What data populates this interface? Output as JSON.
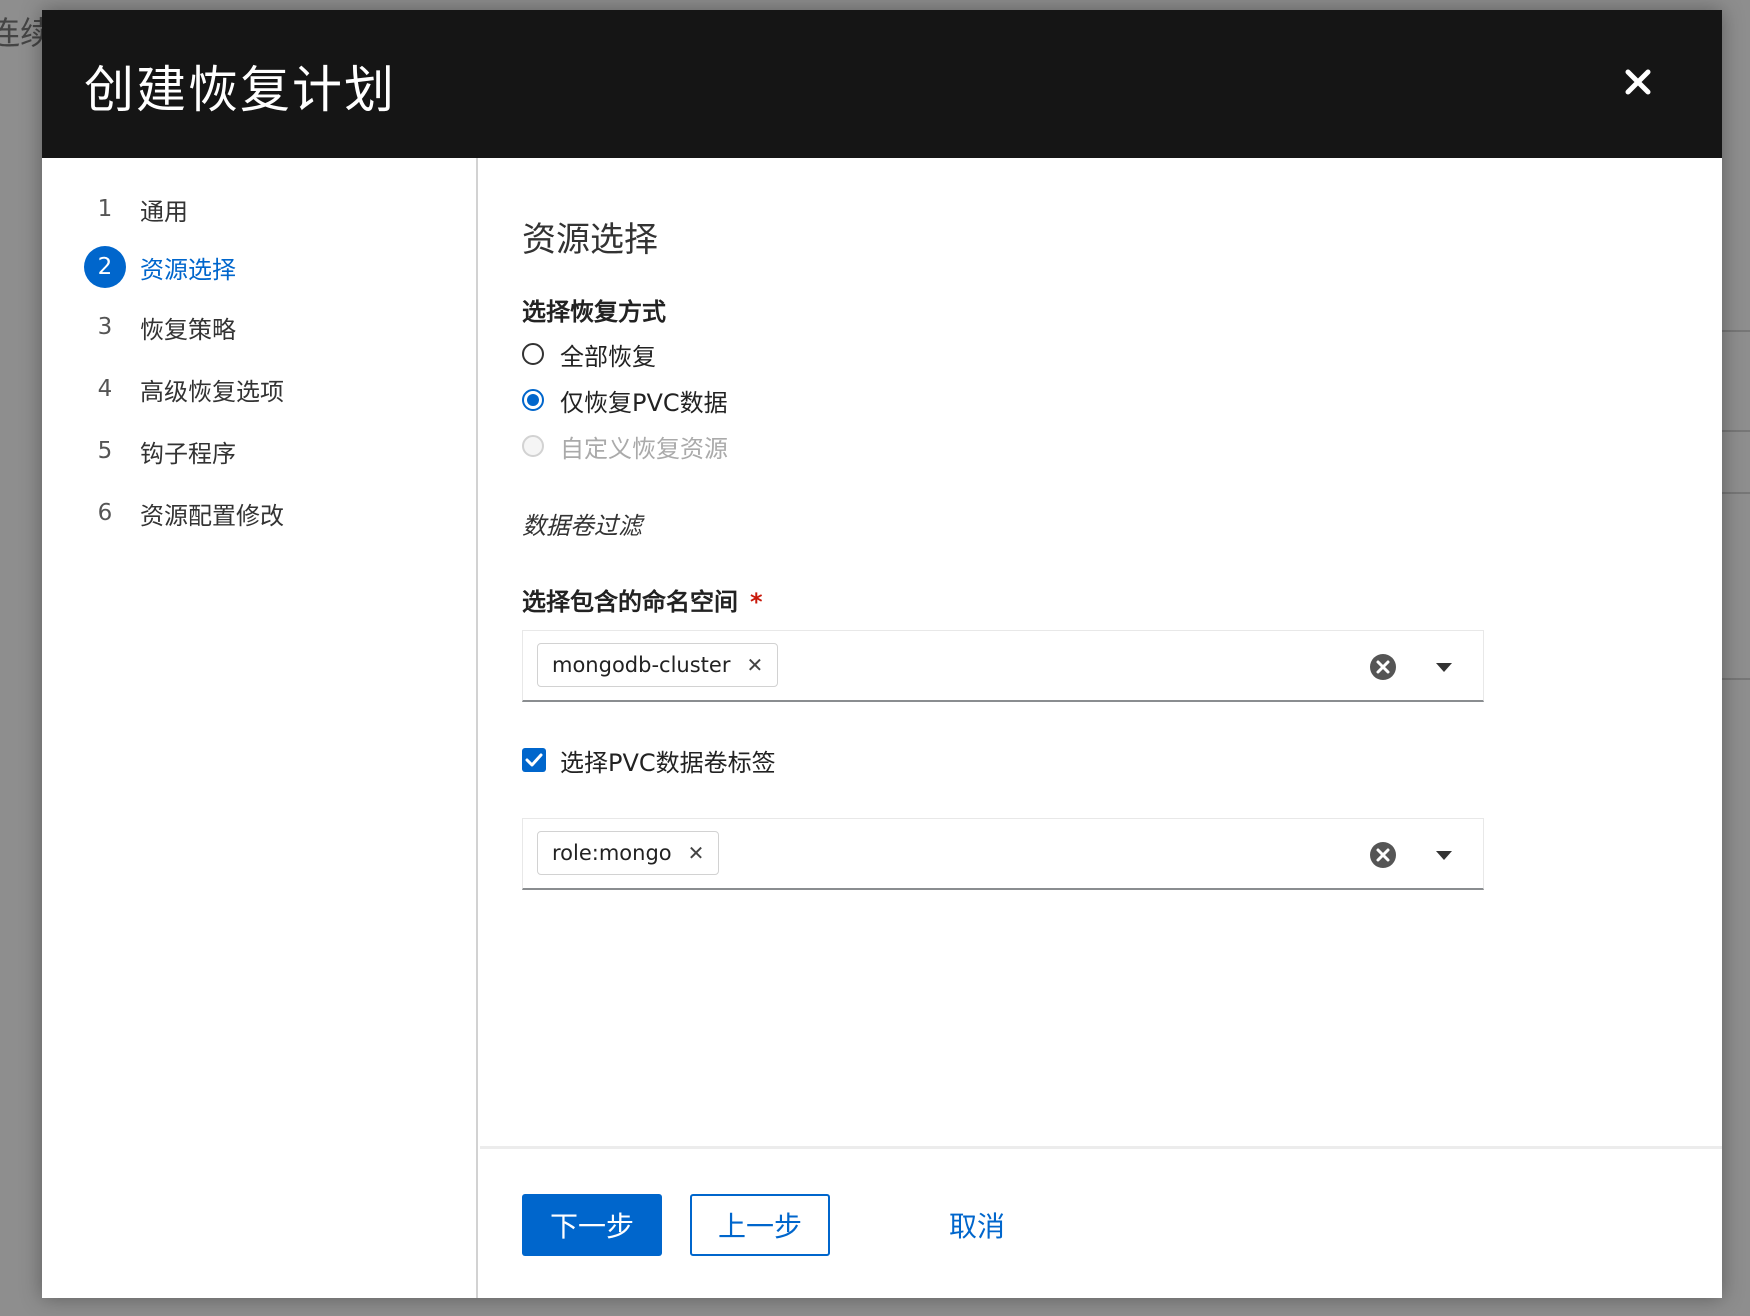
{
  "background": {
    "text": "连续"
  },
  "modal": {
    "title": "创建恢复计划",
    "close_icon": "close-icon"
  },
  "nav": {
    "items": [
      {
        "num": "1",
        "label": "通用",
        "active": false
      },
      {
        "num": "2",
        "label": "资源选择",
        "active": true
      },
      {
        "num": "3",
        "label": "恢复策略",
        "active": false
      },
      {
        "num": "4",
        "label": "高级恢复选项",
        "active": false
      },
      {
        "num": "5",
        "label": "钩子程序",
        "active": false
      },
      {
        "num": "6",
        "label": "资源配置修改",
        "active": false
      }
    ]
  },
  "content": {
    "title": "资源选择",
    "restore_mode": {
      "label": "选择恢复方式",
      "options": [
        {
          "label": "全部恢复",
          "checked": false,
          "disabled": false
        },
        {
          "label": "仅恢复PVC数据",
          "checked": true,
          "disabled": false
        },
        {
          "label": "自定义恢复资源",
          "checked": false,
          "disabled": true
        }
      ]
    },
    "volume_filter_label": "数据卷过滤",
    "namespace": {
      "label": "选择包含的命名空间",
      "required_mark": "*",
      "chips": [
        "mongodb-cluster"
      ]
    },
    "pvc_label_checkbox": {
      "label": "选择PVC数据卷标签",
      "checked": true
    },
    "pvc_labels": {
      "chips": [
        "role:mongo"
      ]
    }
  },
  "footer": {
    "next_label": "下一步",
    "back_label": "上一步",
    "cancel_label": "取消"
  },
  "colors": {
    "accent": "#0066cc",
    "header_bg": "#151515",
    "required": "#c9190b"
  }
}
